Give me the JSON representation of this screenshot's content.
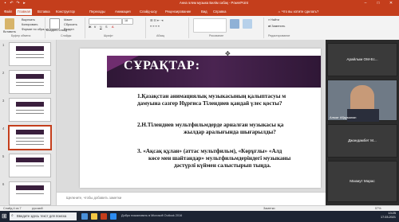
{
  "window": {
    "title": "Анна әлем музыка Билім сабақ - PowerPoint",
    "colors": {
      "accent": "#c43e1c",
      "banner": "#3a1f3d"
    }
  },
  "tabs": {
    "items": [
      "Файл",
      "Главная",
      "Вставка",
      "Конструктор",
      "Переходы",
      "Анимация",
      "Слайд-шоу",
      "Рецензирование",
      "Вид",
      "Справка"
    ],
    "tell_me": "Что вы хотите сделать?"
  },
  "ribbon": {
    "paste": "Вставить",
    "cut": "Вырезать",
    "copy": "Копировать",
    "format_painter": "Формат по образцу",
    "new_slide": "Создать слайд",
    "layout": "Макет",
    "reset": "Сбросить",
    "section": "Раздел",
    "font_size": "18",
    "groups": [
      "Буфер обмена",
      "Слайды",
      "Шрифт",
      "Абзац",
      "Рисование",
      "Редактирование"
    ]
  },
  "thumbnails": {
    "numbers": [
      "1",
      "2",
      "3",
      "4",
      "5",
      "6",
      "7",
      "8"
    ]
  },
  "slide": {
    "title": "СҰРАҚТАР:",
    "lines": [
      "1.Қазақстан анимациялық музыкасының қалыптасуы м",
      "дамуына сазгер Нұрғиса Тілендиев қандай үлес қосты?",
      "2.Н.Тілендиев мультфильмдерде арналған музыкасы қа",
      "жылдар аралығында шығарылды?",
      "3. «Ақсақ құлан» (аттас мультфильм), «Көрұғлы» «Алд",
      "көсе мен шайтандар» мультфильмдеріндегі музыканы",
      "дәстүрлі күймен салыстырып тыңда."
    ]
  },
  "notes": {
    "placeholder": "Щелкните, чтобы добавить заметки"
  },
  "video": {
    "participants": [
      "Арайлым ОМ-Ес...",
      "Алмат Абдуманап",
      "Джандамбет М...",
      "Махмут Марас"
    ]
  },
  "status": {
    "slide_counter": "Слайд 4 из 7",
    "language": "русский",
    "notes_btn": "Заметки",
    "zoom": "57%"
  },
  "taskbar": {
    "search_placeholder": "Введите здесь текст для поиска",
    "app_caption": "Добро пожаловать в Microsoft Outlook 2016",
    "time": "13:25",
    "date": "17.03.2021"
  }
}
